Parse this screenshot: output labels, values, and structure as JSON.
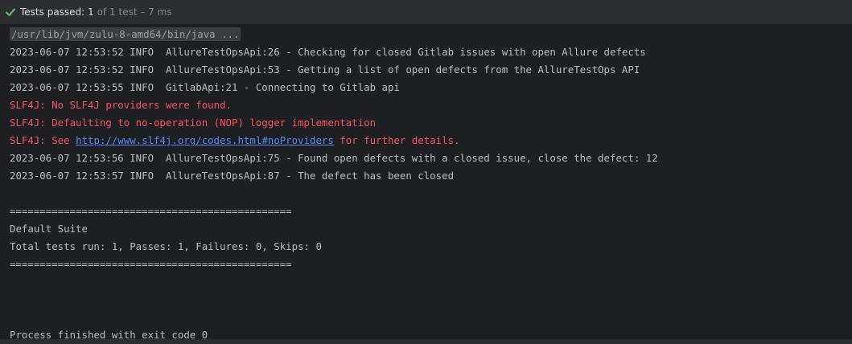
{
  "header": {
    "status_label": "Tests passed: 1",
    "status_detail": "of 1 test – 7 ms",
    "status_color": "#5fb865"
  },
  "console": {
    "command": "/usr/lib/jvm/zulu-8-amd64/bin/java ...",
    "log1": "2023-06-07 12:53:52 INFO  AllureTestOpsApi:26 - Checking for closed Gitlab issues with open Allure defects",
    "log2": "2023-06-07 12:53:52 INFO  AllureTestOpsApi:53 - Getting a list of open defects from the AllureTestOps API",
    "log3": "2023-06-07 12:53:55 INFO  GitlabApi:21 - Connecting to Gitlab api",
    "err1": "SLF4J: No SLF4J providers were found.",
    "err2": "SLF4J: Defaulting to no-operation (NOP) logger implementation",
    "err3_prefix": "SLF4J: See ",
    "err3_link": "http://www.slf4j.org/codes.html#noProviders",
    "err3_suffix": " for further details.",
    "log4": "2023-06-07 12:53:56 INFO  AllureTestOpsApi:75 - Found open defects with a closed issue, close the defect: 12",
    "log5": "2023-06-07 12:53:57 INFO  AllureTestOpsApi:87 - The defect has been closed",
    "separator1": "===============================================",
    "suite_name": "Default Suite",
    "summary": "Total tests run: 1, Passes: 1, Failures: 0, Skips: 0",
    "separator2": "===============================================",
    "exit_message": "Process finished with exit code 0"
  }
}
